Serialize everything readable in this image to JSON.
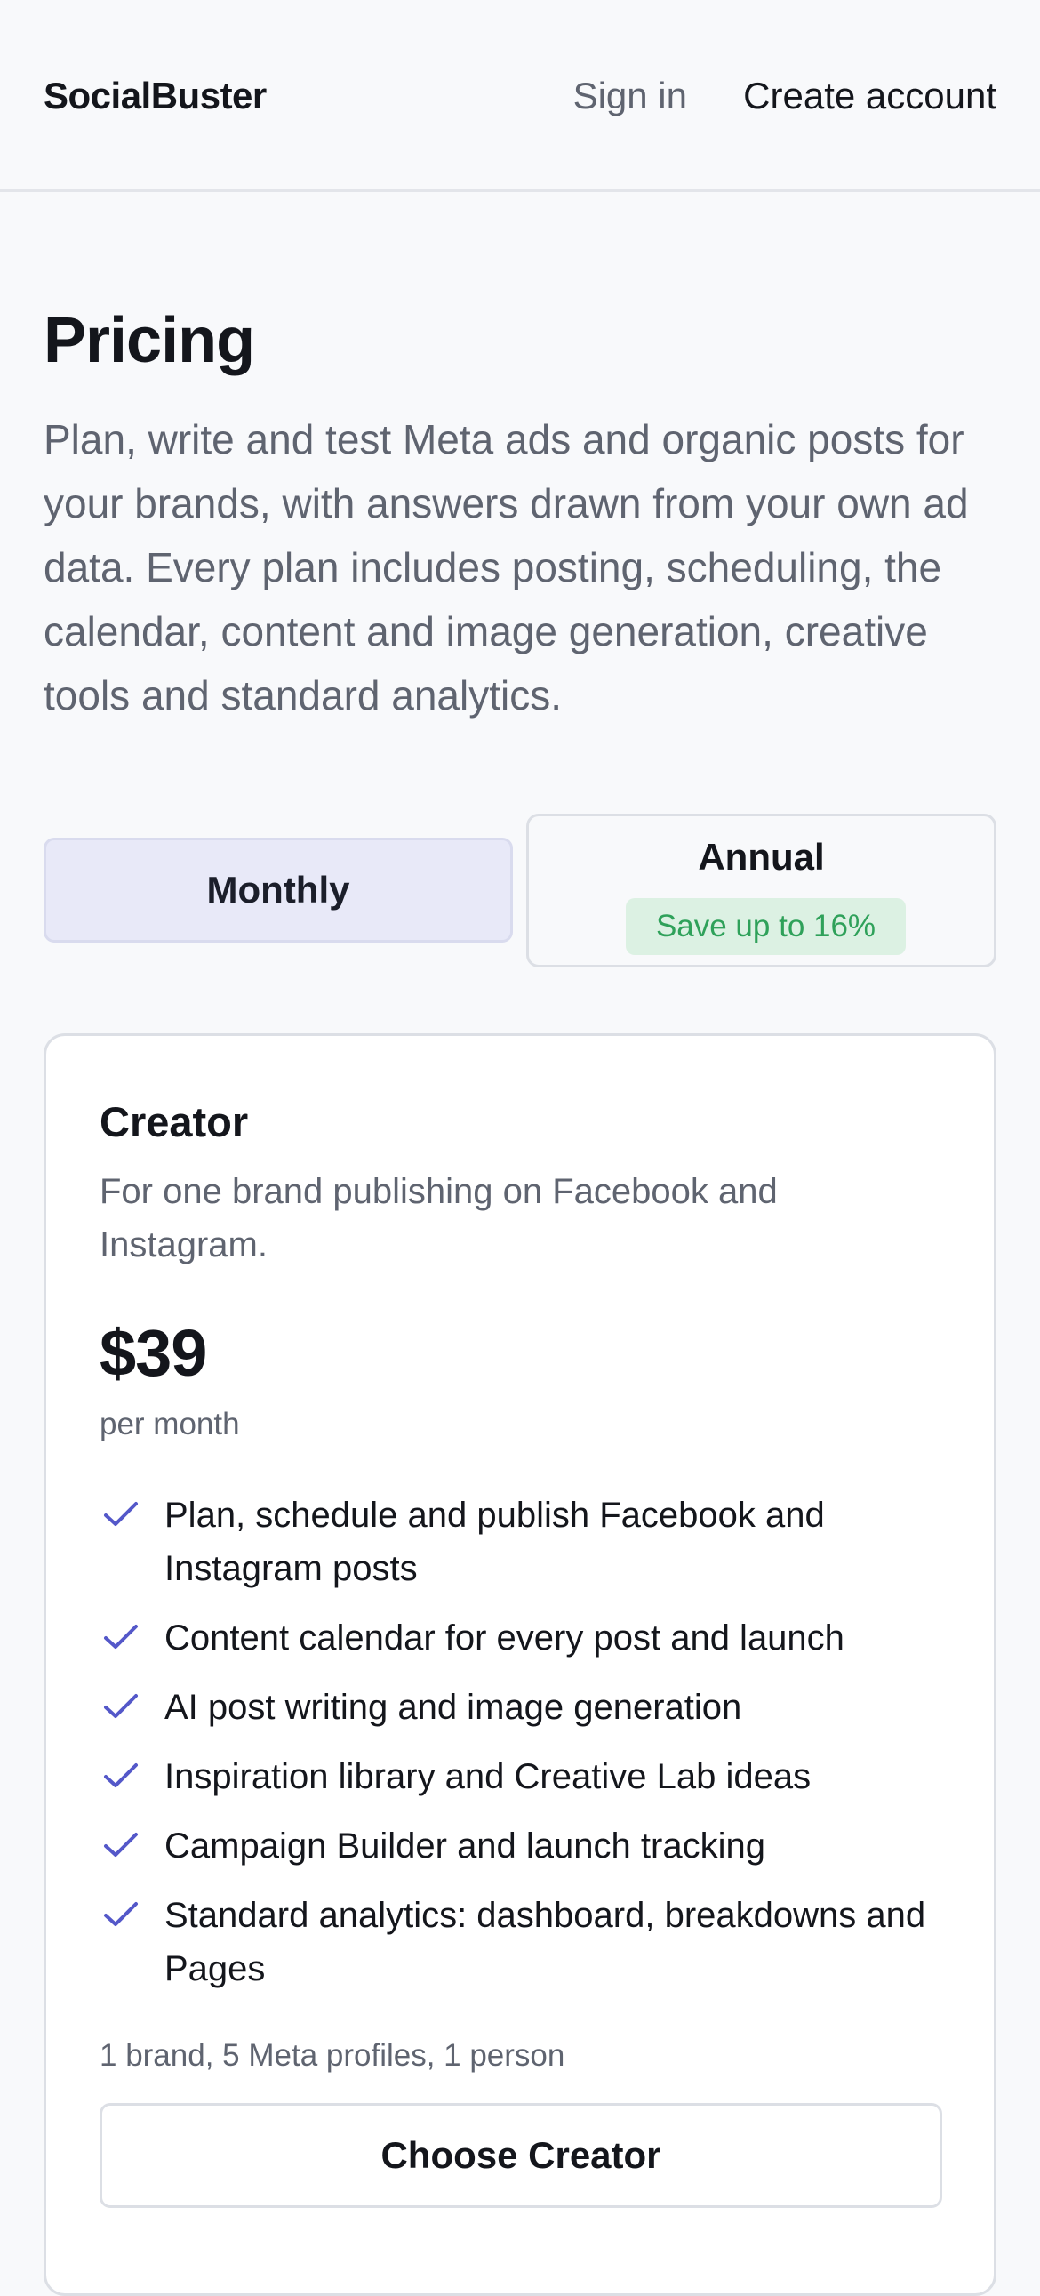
{
  "header": {
    "brand": "SocialBuster",
    "sign_in": "Sign in",
    "create_account": "Create account"
  },
  "page": {
    "title": "Pricing",
    "intro": "Plan, write and test Meta ads and organic posts for your brands, with answers drawn from your own ad data. Every plan includes posting, scheduling, the calendar, content and image generation, creative tools and standard analytics."
  },
  "billing_toggle": {
    "monthly_label": "Monthly",
    "annual_label": "Annual",
    "annual_badge": "Save up to 16%",
    "selected": "Monthly"
  },
  "plan": {
    "name": "Creator",
    "description": "For one brand publishing on Facebook and Instagram.",
    "price": "$39",
    "period": "per month",
    "features": [
      "Plan, schedule and publish Facebook and Instagram posts",
      "Content calendar for every post and launch",
      "AI post writing and image generation",
      "Inspiration library and Creative Lab ideas",
      "Campaign Builder and launch tracking",
      "Standard analytics: dashboard, breakdowns and Pages"
    ],
    "limits": "1 brand, 5 Meta profiles, 1 person",
    "cta": "Choose Creator"
  },
  "icons": {
    "feature_bullet": "check-icon"
  },
  "colors": {
    "accent": "#5458c9",
    "selected_toggle_bg": "#e8e9f8",
    "badge_bg": "#dcf1e3",
    "badge_text": "#2fa15a"
  }
}
